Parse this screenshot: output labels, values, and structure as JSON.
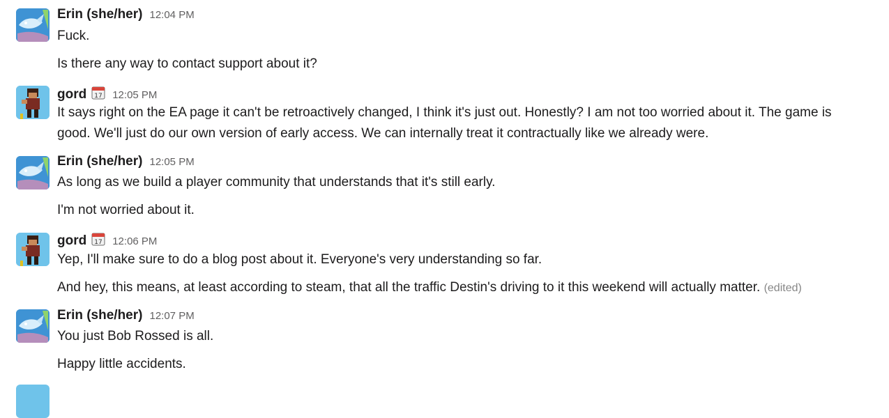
{
  "messages": [
    {
      "author": "Erin (she/her)",
      "time": "12:04 PM",
      "lines": [
        "Fuck.",
        "Is there any way to contact support about it?"
      ]
    },
    {
      "author": "gord",
      "time": "12:05 PM",
      "status_emoji": "calendar-icon",
      "lines": [
        "It says right on the EA page it can't be retroactively changed, I think it's just out. Honestly? I am not too worried about it. The game is",
        "good. We'll just do our own version of early access. We can internally treat it contractually like we already were."
      ]
    },
    {
      "author": "Erin (she/her)",
      "time": "12:05 PM",
      "lines": [
        "As long as we build a player community that understands that it's still early.",
        "I'm not worried about it."
      ]
    },
    {
      "author": "gord",
      "time": "12:06 PM",
      "status_emoji": "calendar-icon",
      "lines": [
        "Yep, I'll make sure to do a blog post about it. Everyone's very understanding so far.",
        "And hey, this means, at least according to steam, that all the traffic Destin's driving to it this weekend will actually matter."
      ],
      "edited_label": "(edited)"
    },
    {
      "author": "Erin (she/her)",
      "time": "12:07 PM",
      "lines": [
        "You just Bob Rossed is all.",
        "Happy little accidents."
      ]
    }
  ],
  "colors": {
    "text": "#1d1c1d",
    "timestamp": "#616061",
    "edited": "#868686"
  }
}
